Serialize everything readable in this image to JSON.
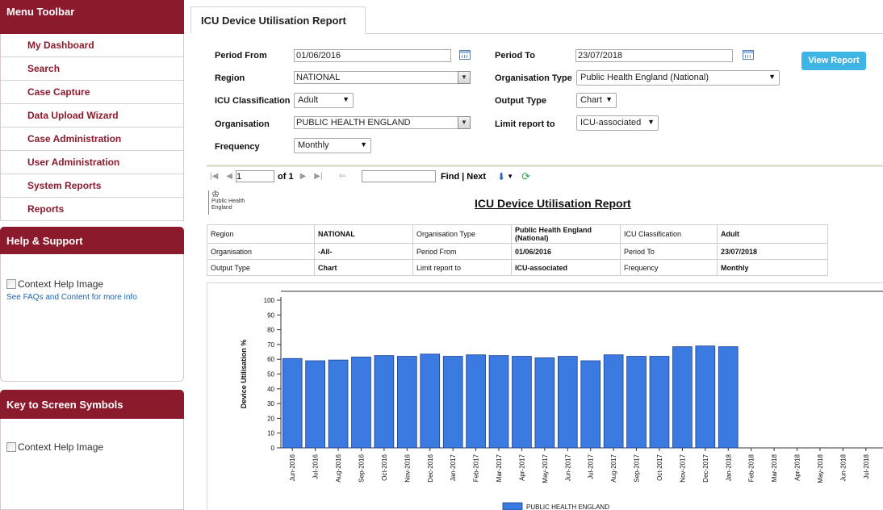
{
  "sidebar": {
    "menu_title": "Menu Toolbar",
    "items": [
      {
        "label": "My Dashboard"
      },
      {
        "label": "Search"
      },
      {
        "label": "Case Capture"
      },
      {
        "label": "Data Upload Wizard"
      },
      {
        "label": "Case Administration"
      },
      {
        "label": "User Administration"
      },
      {
        "label": "System Reports"
      },
      {
        "label": "Reports"
      }
    ],
    "help": {
      "title": "Help & Support",
      "image_alt": "Context Help Image",
      "link": "See FAQs and Content for more info"
    },
    "key": {
      "title": "Key to Screen Symbols",
      "image_alt": "Context Help Image"
    }
  },
  "tab": {
    "label": "ICU Device Utilisation Report"
  },
  "form": {
    "period_from": {
      "label": "Period From",
      "value": "01/06/2016"
    },
    "period_to": {
      "label": "Period To",
      "value": "23/07/2018"
    },
    "region": {
      "label": "Region",
      "value": "NATIONAL"
    },
    "organisation_type": {
      "label": "Organisation Type",
      "value": "Public Health England (National)"
    },
    "icu_classification": {
      "label": "ICU Classification",
      "value": "Adult"
    },
    "output_type": {
      "label": "Output Type",
      "value": "Chart"
    },
    "organisation": {
      "label": "Organisation",
      "value": "PUBLIC HEALTH ENGLAND"
    },
    "limit_report_to": {
      "label": "Limit report to",
      "value": "ICU-associated"
    },
    "frequency": {
      "label": "Frequency",
      "value": "Monthly"
    },
    "view_report": "View Report"
  },
  "report_toolbar": {
    "page_value": "1",
    "of_pages": "of 1",
    "find_value": "",
    "find_label": "Find",
    "separator": "|",
    "next_label": "Next"
  },
  "report": {
    "title": "ICU Device Utilisation Report",
    "logo_lines": [
      "Public Health",
      "England"
    ],
    "params": [
      [
        "Region",
        "NATIONAL",
        "Organisation Type",
        "Public Health England (National)",
        "ICU Classification",
        "Adult"
      ],
      [
        "Organisation",
        "-All-",
        "Period From",
        "01/06/2016",
        "Period To",
        "23/07/2018"
      ],
      [
        "Output Type",
        "Chart",
        "Limit report to",
        "ICU-associated",
        "Frequency",
        "Monthly"
      ]
    ]
  },
  "chart_data": {
    "type": "bar",
    "ylabel": "Device Utilisation %",
    "xlabel": "",
    "ylim": [
      0,
      100
    ],
    "yticks": [
      0,
      10,
      20,
      30,
      40,
      50,
      60,
      70,
      80,
      90,
      100
    ],
    "grid": false,
    "legend_position": "bottom",
    "bar_color": "#3b7ae0",
    "categories": [
      "Jun-2016",
      "Jul-2016",
      "Aug-2016",
      "Sep-2016",
      "Oct-2016",
      "Nov-2016",
      "Dec-2016",
      "Jan-2017",
      "Feb-2017",
      "Mar-2017",
      "Apr-2017",
      "May-2017",
      "Jun-2017",
      "Jul-2017",
      "Aug-2017",
      "Sep-2017",
      "Oct-2017",
      "Nov-2017",
      "Dec-2017",
      "Jan-2018",
      "Feb-2018",
      "Mar-2018",
      "Apr-2018",
      "May-2018",
      "Jun-2018",
      "Jul-2018"
    ],
    "series": [
      {
        "name": "PUBLIC HEALTH ENGLAND",
        "values": [
          60.5,
          59,
          59.5,
          61.5,
          62.5,
          62,
          63.5,
          62,
          63,
          62.5,
          62,
          61,
          62,
          59,
          63,
          62,
          62,
          68.5,
          69,
          68.5,
          null,
          null,
          null,
          null,
          null,
          null
        ]
      }
    ]
  }
}
